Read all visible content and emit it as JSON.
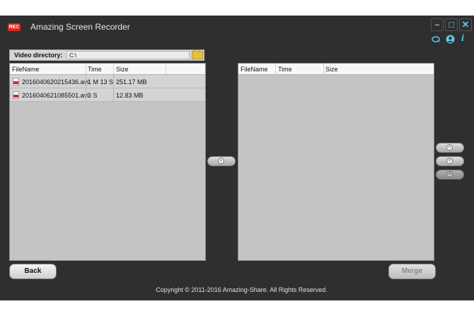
{
  "app": {
    "logo_text": "REC",
    "title": "Amazing Screen Recorder",
    "window_buttons": {
      "minimize": "–",
      "maximize": "□",
      "close": "✕"
    },
    "tool_icons": [
      "speech-bubble-icon",
      "account-icon",
      "info-icon"
    ],
    "accent_color": "#5ec8e8",
    "logo_color": "#d8281e"
  },
  "video_directory": {
    "label": "Video directory:",
    "value": "C:\\"
  },
  "left_table": {
    "headers": [
      "FileName",
      "Time",
      "Size"
    ],
    "rows": [
      {
        "filename": "2016040620215436.avi",
        "time": "1 M 13 S",
        "size": "251.17 MB"
      },
      {
        "filename": "2016040621085501.avi",
        "time": "3 S",
        "size": "12.83 MB"
      }
    ]
  },
  "right_table": {
    "headers": [
      "FileName",
      "Time",
      "Size"
    ],
    "rows": []
  },
  "buttons": {
    "back": "Back",
    "merge": "Merge",
    "add_glyph": "+",
    "move_up_glyph": "˄",
    "move_down_glyph": "˅",
    "remove_glyph": "×"
  },
  "footer": {
    "copyright": "Copyright © 2011-2016 Amazing-Share. All Rights Reserved."
  }
}
